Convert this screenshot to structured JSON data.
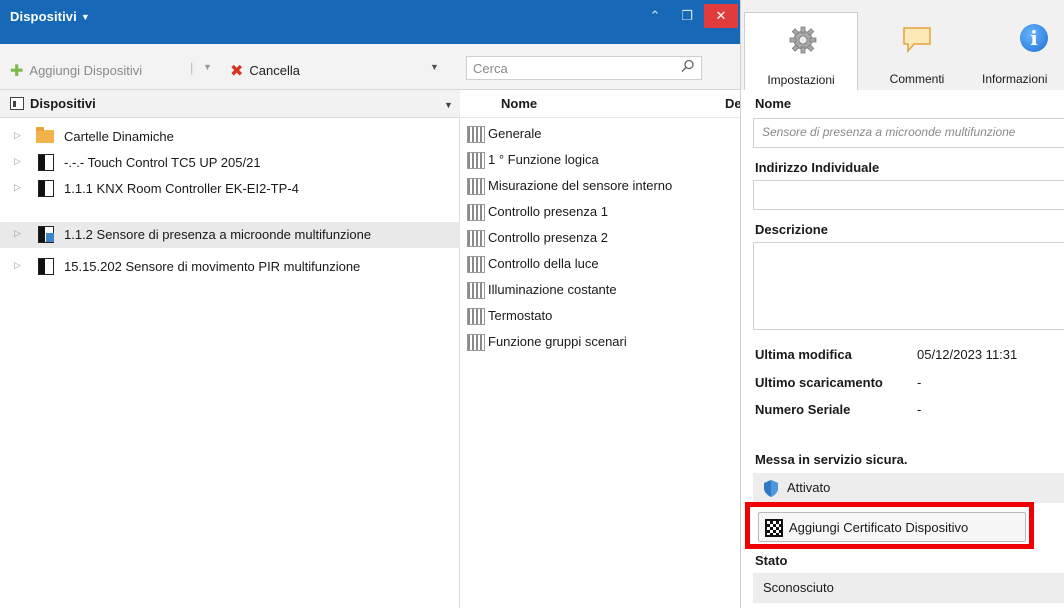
{
  "window": {
    "title": "Dispositivi",
    "close_glyph": "✕",
    "up_glyph": "⌃",
    "restore_glyph": "❐"
  },
  "toolbar": {
    "add_label": "Aggiungi Dispositivi",
    "delete_label": "Cancella",
    "search_placeholder": "Cerca"
  },
  "tree": {
    "header": "Dispositivi",
    "items": [
      {
        "label": "Cartelle Dinamiche",
        "icon": "folder-icon",
        "selected": false
      },
      {
        "label": "-.-.- Touch Control TC5 UP 205/21",
        "icon": "device-icon",
        "selected": false
      },
      {
        "label": "1.1.1 KNX Room Controller EK-EI2-TP-4",
        "icon": "device-icon",
        "selected": false
      },
      {
        "label": "1.1.2 Sensore di presenza a microonde multifunzione",
        "icon": "device-blue-icon",
        "selected": true
      },
      {
        "label": "15.15.202 Sensore di movimento PIR multifunzione",
        "icon": "device-icon",
        "selected": false
      }
    ]
  },
  "list": {
    "col_name": "Nome",
    "col_desc": "De",
    "items": [
      "Generale",
      "1 ° Funzione logica",
      "Misurazione del sensore interno",
      "Controllo presenza 1",
      "Controllo presenza 2",
      "Controllo della luce",
      "Illuminazione costante",
      "Termostato",
      "Funzione gruppi scenari"
    ]
  },
  "properties": {
    "tabs": [
      {
        "label": "Impostazioni",
        "icon": "gear-icon"
      },
      {
        "label": "Commenti",
        "icon": "comment-icon"
      },
      {
        "label": "Informazioni",
        "icon": "info-icon"
      }
    ],
    "name_label": "Nome",
    "name_placeholder": "Sensore di presenza a microonde multifunzione",
    "individual_address_label": "Indirizzo Individuale",
    "individual_address_value": "",
    "description_label": "Descrizione",
    "description_value": "",
    "last_modified_label": "Ultima modifica",
    "last_modified_value": "05/12/2023 11:31",
    "last_download_label": "Ultimo scaricamento",
    "last_download_value": "-",
    "serial_label": "Numero Seriale",
    "serial_value": "-",
    "secure_label": "Messa in servizio sicura.",
    "secure_value": "Attivato",
    "cert_button": "Aggiungi Certificato Dispositivo",
    "status_label": "Stato",
    "status_value": "Sconosciuto"
  },
  "colors": {
    "titlebar": "#1769b8",
    "highlight": "#f00000",
    "close": "#e03c3c"
  }
}
